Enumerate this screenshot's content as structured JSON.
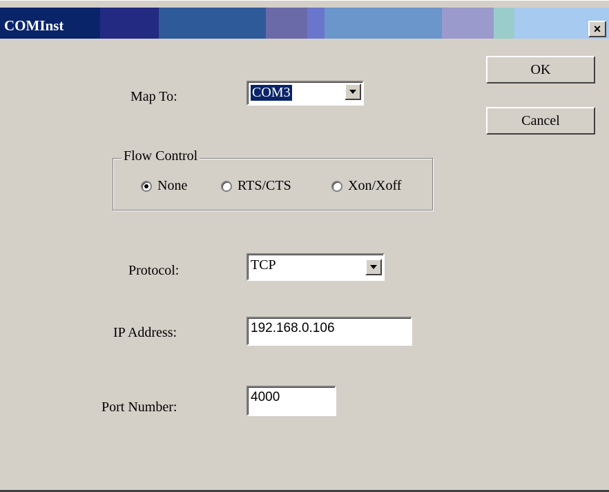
{
  "window": {
    "title": "COMInst",
    "close_label": "×",
    "titlebar_colors": [
      "#0a246a",
      "#232a82",
      "#2f5a9a",
      "#6a6aa8",
      "#6a76cc",
      "#6a96cc",
      "#9a9acc",
      "#9acccc",
      "#a6caf0"
    ]
  },
  "buttons": {
    "ok_label": "OK",
    "cancel_label": "Cancel"
  },
  "map_to": {
    "label": "Map To:",
    "value": "COM3"
  },
  "flow_control": {
    "title": "Flow Control",
    "options": [
      {
        "label": "None",
        "selected": true
      },
      {
        "label": "RTS/CTS",
        "selected": false
      },
      {
        "label": "Xon/Xoff",
        "selected": false
      }
    ]
  },
  "protocol": {
    "label": "Protocol:",
    "value": "TCP"
  },
  "ip_address": {
    "label": "IP Address:",
    "value": "192.168.0.106"
  },
  "port_number": {
    "label": "Port Number:",
    "value": "4000"
  },
  "icons": {
    "dropdown": "chevron-down-icon",
    "close": "close-icon"
  }
}
